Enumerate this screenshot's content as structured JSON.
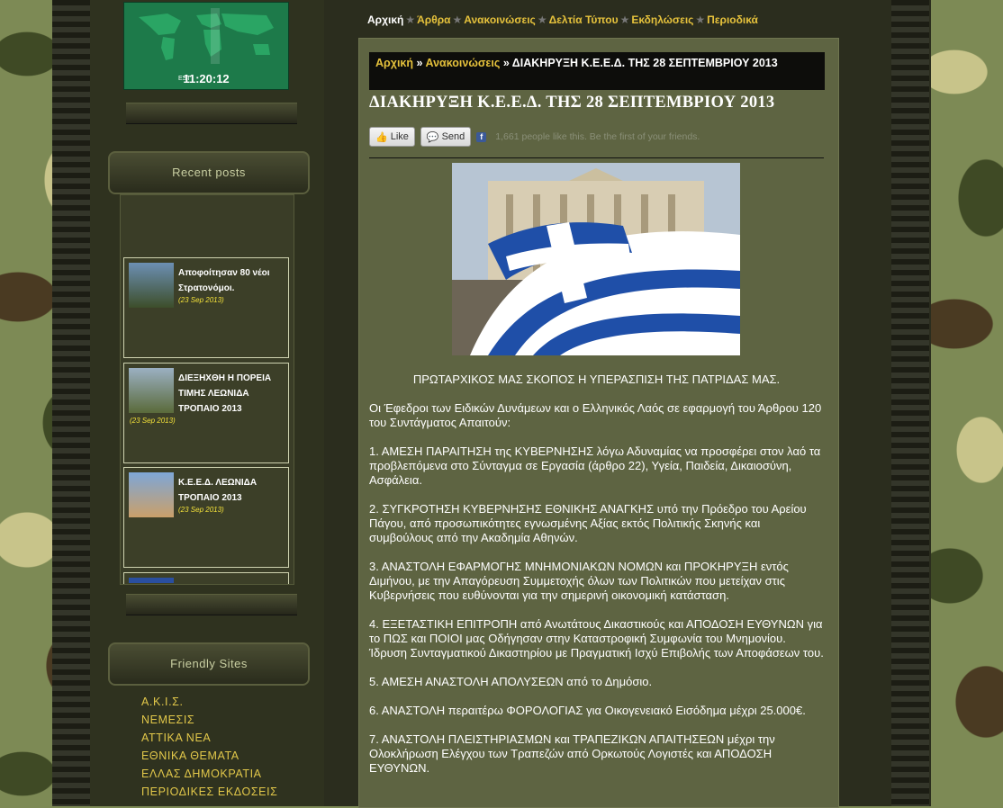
{
  "clock": {
    "time": "11:20:12",
    "zone": "EST"
  },
  "sidebar": {
    "recent_title": "Recent posts",
    "posts": [
      {
        "title": "Αποφοίτησαν 80 νέοι Στρατονόμοι.",
        "date": "(23 Sep 2013)"
      },
      {
        "title": "ΔΙΕΞΗΧΘΗ Η ΠΟΡΕΙΑ ΤΙΜΗΣ ΛΕΩΝΙΔΑ ΤΡΟΠΑΙΟ 2013",
        "date": "(23 Sep 2013)"
      },
      {
        "title": "Κ.Ε.Ε.Δ. ΛΕΩΝΙΔΑ ΤΡΟΠΑΙΟ 2013",
        "date": "(23 Sep 2013)"
      }
    ],
    "friendly_title": "Friendly Sites",
    "friendly": [
      "Α.Κ.Ι.Σ.",
      "ΝΕΜΕΣΙΣ",
      "ΑΤΤΙΚΑ ΝΕΑ",
      "ΕΘΝΙΚΑ ΘΕΜΑΤΑ",
      "ΕΛΛΑΣ ΔΗΜΟΚΡΑΤΙΑ",
      "ΠΕΡΙΟΔΙΚΕΣ ΕΚΔΟΣΕΙΣ"
    ]
  },
  "nav": [
    "Αρχική",
    "Άρθρα",
    "Ανακοινώσεις",
    "Δελτία Τύπου",
    "Εκδηλώσεις",
    "Περιοδικά"
  ],
  "breadcrumb": {
    "home": "Αρχική",
    "section": "Ανακοινώσεις",
    "sep": "»",
    "current": "ΔΙΑΚΗΡΥΞΗ Κ.Ε.Ε.Δ. ΤΗΣ 28 ΣΕΠΤΕΜΒΡΙΟΥ 2013"
  },
  "article": {
    "title": "ΔΙΑΚΗΡΥΞΗ Κ.Ε.Ε.Δ. ΤΗΣ 28 ΣΕΠΤΕΜΒΡΙΟΥ 2013",
    "like_label": "Like",
    "send_label": "Send",
    "fb_text": "1,661 people like this. Be the first of your friends.",
    "lead": "ΠΡΩΤΑΡΧΙΚΟΣ ΜΑΣ ΣΚΟΠΟΣ Η ΥΠΕΡΑΣΠΙΣΗ ΤΗΣ ΠΑΤΡΙΔΑΣ ΜΑΣ.",
    "paragraphs": [
      "Οι Έφεδροι των Ειδικών Δυνάμεων και ο Ελληνικός Λαός σε εφαρμογή του Άρθρου 120 του Συντάγματος Απαιτούν:",
      "1. ΑΜΕΣΗ ΠΑΡΑΙΤΗΣΗ της ΚΥΒΕΡΝΗΣΗΣ λόγω Αδυναμίας να προσφέρει στον λαό τα προβλεπόμενα στο Σύνταγμα σε Εργασία (άρθρο 22), Υγεία, Παιδεία, Δικαιοσύνη, Ασφάλεια.",
      "2. ΣΥΓΚΡΟΤΗΣΗ ΚΥΒΕΡΝΗΣΗΣ ΕΘΝΙΚΗΣ ΑΝΑΓΚΗΣ υπό την Πρόεδρο του Αρείου Πάγου, από προσωπικότητες εγνωσμένης Αξίας εκτός Πολιτικής Σκηνής και συμβούλους από την Ακαδημία Αθηνών.",
      "3. ΑΝΑΣΤΟΛΗ ΕΦΑΡΜΟΓΗΣ ΜΝΗΜΟΝΙΑΚΩΝ ΝΟΜΩΝ και ΠΡΟΚΗΡΥΞΗ εντός Διμήνου, με την Απαγόρευση Συμμετοχής όλων των Πολιτικών που μετείχαν στις Κυβερνήσεις που ευθύνονται για την σημερινή οικονομική κατάσταση.",
      "4. ΕΞΕΤΑΣΤΙΚΗ ΕΠΙΤΡΟΠΗ από Ανωτάτους Δικαστικούς και ΑΠΟΔΟΣΗ ΕΥΘΥΝΩΝ για το ΠΩΣ και ΠΟΙΟΙ μας Οδήγησαν στην Καταστροφική Συμφωνία του Μνημονίου. Ίδρυση Συνταγματικού Δικαστηρίου με Πραγματική Ισχύ Επιβολής των Αποφάσεων του.",
      "5. ΑΜΕΣΗ ΑΝΑΣΤΟΛΗ ΑΠΟΛΥΣΕΩΝ από το Δημόσιο.",
      "6. ΑΝΑΣΤΟΛΗ περαιτέρω ΦΟΡΟΛΟΓΙΑΣ για Οικογενειακό Εισόδημα μέχρι 25.000€.",
      "7. ΑΝΑΣΤΟΛΗ ΠΛΕΙΣΤΗΡΙΑΣΜΩΝ και ΤΡΑΠΕΖΙΚΩΝ ΑΠΑΙΤΗΣΕΩΝ μέχρι την Ολοκλήρωση Ελέγχου των Τραπεζών από Ορκωτούς Λογιστές και ΑΠΟΔΟΣΗ ΕΥΘΥΝΩΝ."
    ]
  }
}
